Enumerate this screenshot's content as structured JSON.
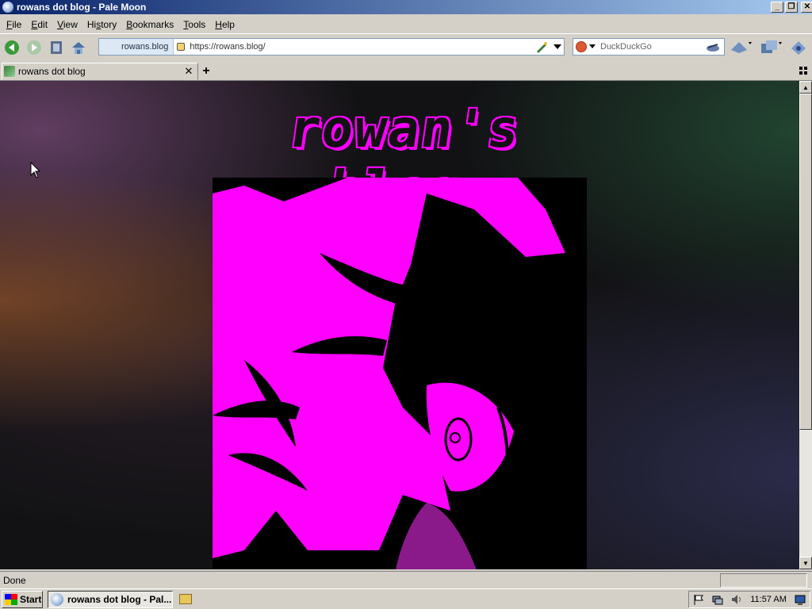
{
  "window": {
    "title": "rowans dot blog - Pale Moon"
  },
  "menu": [
    {
      "pre": "",
      "key": "F",
      "post": "ile"
    },
    {
      "pre": "",
      "key": "E",
      "post": "dit"
    },
    {
      "pre": "",
      "key": "V",
      "post": "iew"
    },
    {
      "pre": "Hi",
      "key": "s",
      "post": "tory"
    },
    {
      "pre": "",
      "key": "B",
      "post": "ookmarks"
    },
    {
      "pre": "",
      "key": "T",
      "post": "ools"
    },
    {
      "pre": "",
      "key": "H",
      "post": "elp"
    }
  ],
  "navbar": {
    "identity_label": "rowans.blog",
    "url": "https://rowans.blog/",
    "search_engine": "DuckDuckGo",
    "search_placeholder": "DuckDuckGo"
  },
  "tabs": [
    {
      "label": "rowans dot blog"
    }
  ],
  "page": {
    "blog_title": "rowan's blog",
    "accent_color": "#ff00ff"
  },
  "status": {
    "text": "Done"
  },
  "taskbar": {
    "start_label": "Start",
    "task_label": "rowans dot blog - Pal...",
    "clock": "11:57 AM"
  }
}
